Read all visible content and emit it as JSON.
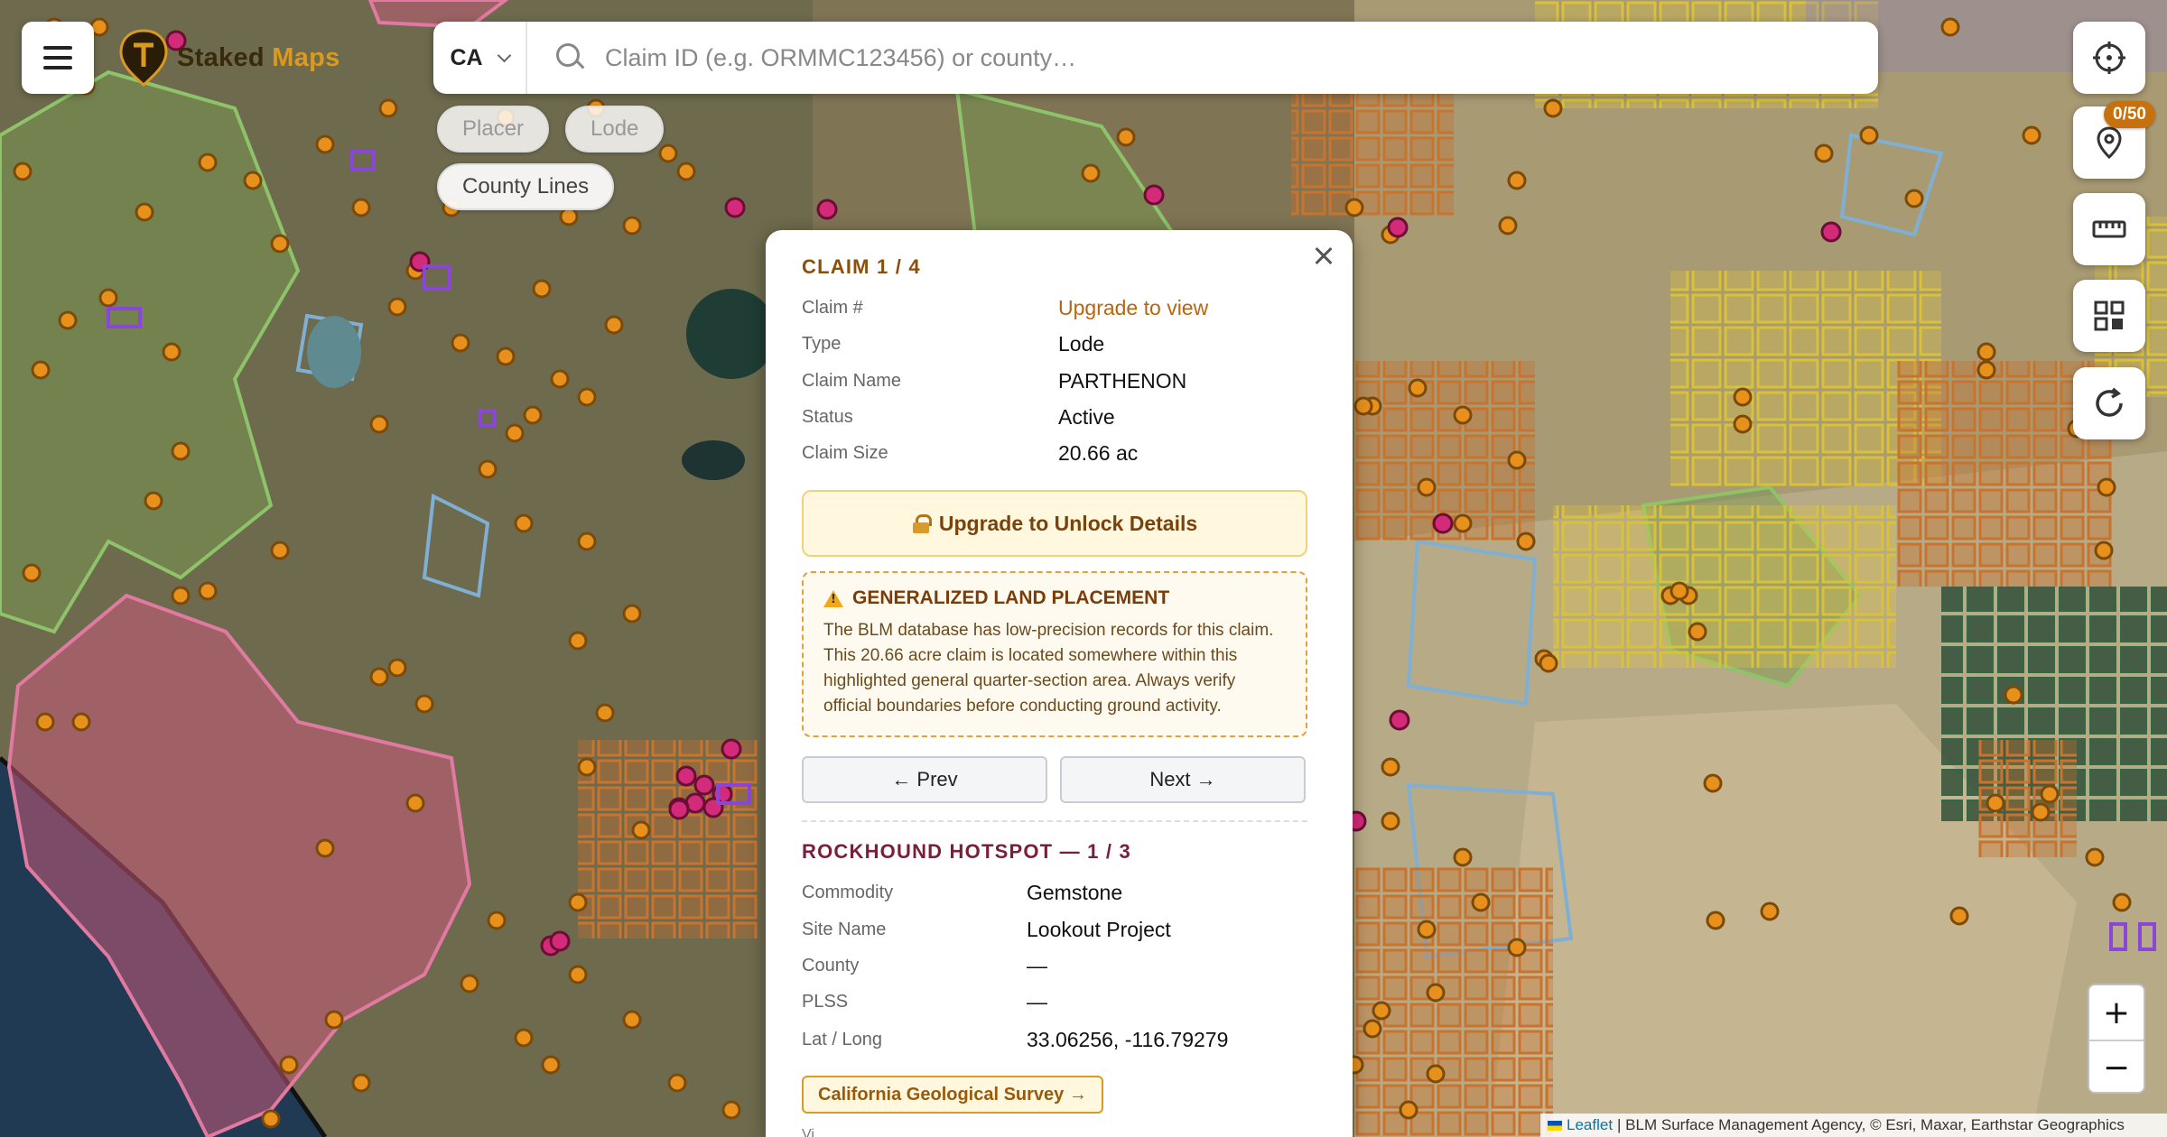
{
  "app": {
    "brand_part1": "Staked",
    "brand_part2": "Maps",
    "accent_color": "#d99a1f"
  },
  "search": {
    "state_value": "CA",
    "placeholder": "Claim ID (e.g. ORMMC123456) or county…"
  },
  "filters": [
    {
      "label": "Placer",
      "active": false
    },
    {
      "label": "Lode",
      "active": false
    },
    {
      "label": "County Lines",
      "active": true
    }
  ],
  "toolbar": {
    "icons": [
      "crosshair-icon",
      "map-pin-icon",
      "ruler-icon",
      "grid-layers-icon",
      "refresh-icon"
    ],
    "pin_badge": "0/50",
    "zoom_in": "+",
    "zoom_out": "−"
  },
  "attribution": {
    "link": "Leaflet",
    "text": "| BLM Surface Management Agency, © Esri, Maxar, Earthstar Geographics"
  },
  "claim": {
    "title": "CLAIM 1 / 4",
    "rows": [
      {
        "label": "Claim #",
        "value": "Upgrade to view"
      },
      {
        "label": "Type",
        "value": "Lode"
      },
      {
        "label": "Claim Name",
        "value": "PARTHENON"
      },
      {
        "label": "Status",
        "value": "Active"
      },
      {
        "label": "Claim Size",
        "value": "20.66 ac"
      }
    ],
    "upgrade_label": "Upgrade to Unlock Details",
    "warning_title": "GENERALIZED LAND PLACEMENT",
    "warning_text": "The BLM database has low-precision records for this claim. This 20.66 acre claim is located somewhere within this highlighted general quarter-section area. Always verify official boundaries before conducting ground activity.",
    "prev_label": "← Prev",
    "next_label": "Next →"
  },
  "hotspot": {
    "title": "ROCKHOUND HOTSPOT — 1 / 3",
    "rows": [
      {
        "label": "Commodity",
        "value": "Gemstone"
      },
      {
        "label": "Site Name",
        "value": "Lookout Project"
      },
      {
        "label": "County",
        "value": "—"
      },
      {
        "label": "PLSS",
        "value": "—"
      },
      {
        "label": "Lat / Long",
        "value": "33.06256, -116.79279"
      }
    ],
    "source_label": "California Geological Survey →",
    "footer_text": "Vi..."
  }
}
